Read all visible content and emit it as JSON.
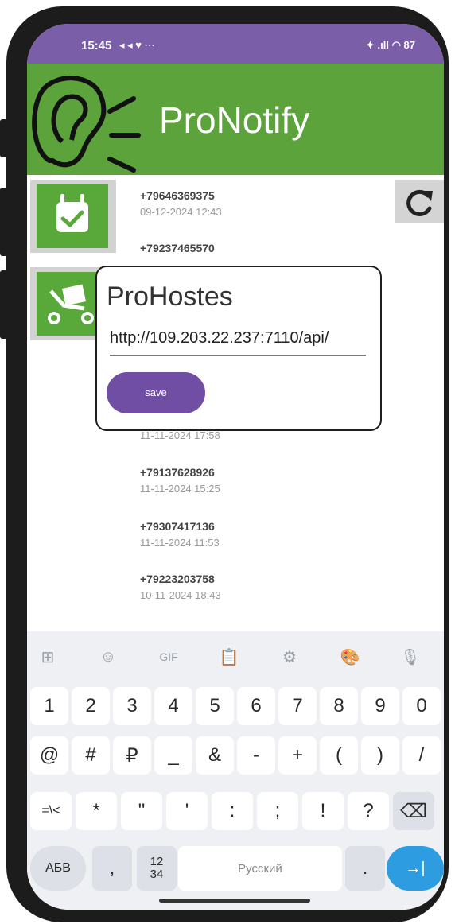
{
  "status": {
    "time": "15:45",
    "indicators_left": "◂ ◂ ♥ ···",
    "indicators_right": "✦ .ıll ◠ 87"
  },
  "app": {
    "title": "ProNotify"
  },
  "entries": [
    {
      "phone": "+79646369375",
      "date": "09-12-2024 12:43"
    },
    {
      "phone": "+79237465570",
      "date": ""
    },
    {
      "phone": "",
      "date": "11-11-2024 17:58"
    },
    {
      "phone": "+79137628926",
      "date": "11-11-2024 15:25"
    },
    {
      "phone": "+79307417136",
      "date": "11-11-2024 11:53"
    },
    {
      "phone": "+79223203758",
      "date": "10-11-2024 18:43"
    }
  ],
  "dialog": {
    "title": "ProHostes",
    "input_value": "http://109.203.22.237:7110/api/",
    "save_label": "save"
  },
  "keyboard": {
    "toolbar": [
      {
        "icon": "apps-icon",
        "glyph": "⊞"
      },
      {
        "icon": "sticker-icon",
        "glyph": "☺"
      },
      {
        "icon": "gif-icon",
        "glyph": "GIF"
      },
      {
        "icon": "clipboard-icon",
        "glyph": "📋"
      },
      {
        "icon": "settings-icon",
        "glyph": "⚙"
      },
      {
        "icon": "palette-icon",
        "glyph": "🎨"
      },
      {
        "icon": "mic-icon",
        "glyph": "🎙"
      }
    ],
    "row1": [
      "1",
      "2",
      "3",
      "4",
      "5",
      "6",
      "7",
      "8",
      "9",
      "0"
    ],
    "row2": [
      "@",
      "#",
      "₽",
      "_",
      "&",
      "-",
      "+",
      "(",
      ")",
      "/"
    ],
    "row3": [
      "=\\<",
      "*",
      "\"",
      "'",
      ":",
      ";",
      "!",
      "?",
      "⌫"
    ],
    "row4": {
      "abc": "АБВ",
      "comma": ",",
      "numpad": "12\n34",
      "space": "Русский",
      "period": ".",
      "enter": "→|"
    }
  },
  "colors": {
    "statusbar": "#7b5ea8",
    "appbar": "#5ba33a",
    "icon_green": "#59a93a",
    "save_button": "#6f4ea3",
    "enter_key": "#2d9ce0"
  }
}
